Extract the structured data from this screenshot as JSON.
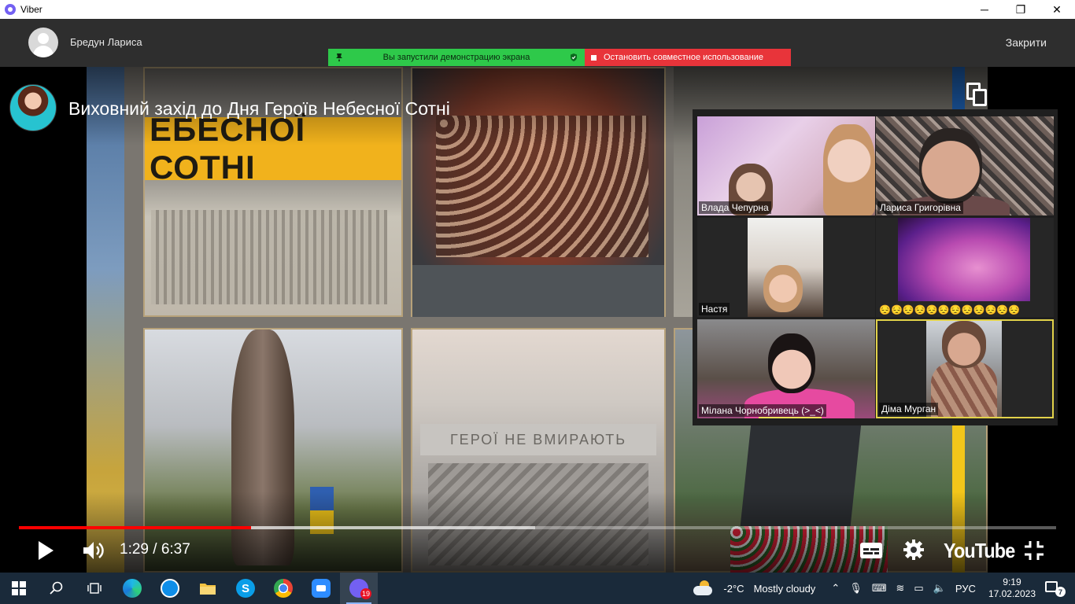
{
  "window": {
    "title": "Viber",
    "minimize": "─",
    "maximize": "❐",
    "close": "✕"
  },
  "call": {
    "caller_name": "Бредун Лариса",
    "close_label": "Закрити",
    "share_active_text": "Вы запустили демонстрацию экрана",
    "stop_share_text": "Остановить совместное использование"
  },
  "youtube": {
    "video_title": "Виховний захід до Дня Героїв Небесної Сотні",
    "time": "1:29 / 6:37",
    "logo": "YouTube",
    "played_fraction": 0.224,
    "buffered_fraction": 0.498
  },
  "video_content": {
    "banner_text": "ЕБЕСНОЇ СОТНІ",
    "plaque_text": "ГЕРОЇ НЕ ВМИРАЮТЬ"
  },
  "participants": [
    {
      "name": "Влада Чепурна"
    },
    {
      "name": "Лариса Григорівна"
    },
    {
      "name": "Настя"
    },
    {
      "name": "😔😔😔😔😔😔😔😔😔😔😔😔"
    },
    {
      "name": "Мілана Чорнобривець (>_<)"
    },
    {
      "name": "Діма Мурган"
    }
  ],
  "taskbar": {
    "viber_badge": "19",
    "weather_temp": "-2°C",
    "weather_text": "Mostly cloudy",
    "language": "РУС",
    "time": "9:19",
    "date": "17.02.2023",
    "notifications": "7"
  },
  "colors": {
    "share_green": "#2ec94a",
    "share_red": "#e8343a",
    "yt_red": "#ff0000",
    "active_speaker": "#e2d24a",
    "taskbar": "#1a2a3a"
  }
}
